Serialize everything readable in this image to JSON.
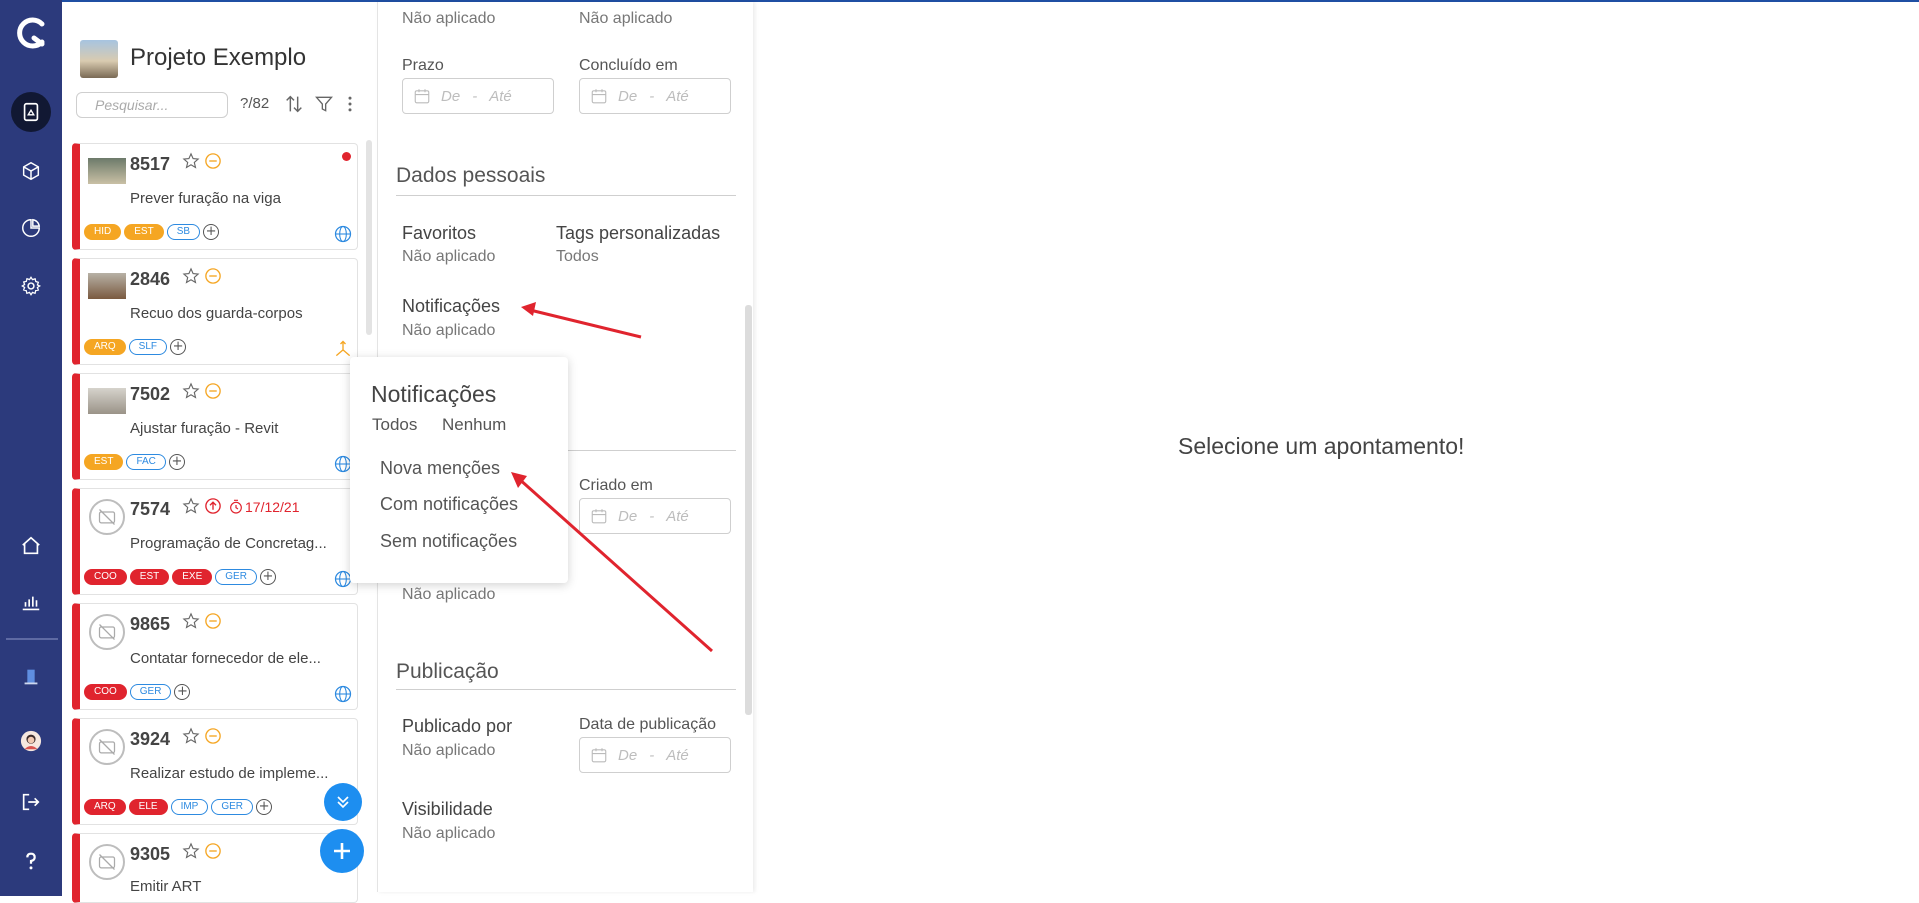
{
  "project": {
    "title": "Projeto Exemplo"
  },
  "search": {
    "placeholder": "Pesquisar..."
  },
  "list": {
    "count": "?/82"
  },
  "cards": [
    {
      "num": "8517",
      "desc": "Prever furação na viga",
      "tags": [
        "HID",
        "EST",
        "SB"
      ]
    },
    {
      "num": "2846",
      "desc": "Recuo dos guarda-corpos",
      "tags": [
        "ARQ",
        "SLF"
      ]
    },
    {
      "num": "7502",
      "desc": "Ajustar furação - Revit",
      "tags": [
        "EST",
        "FAC"
      ]
    },
    {
      "num": "7574",
      "desc": "Programação de Concretag...",
      "date": "17/12/21",
      "tags": [
        "COO",
        "EST",
        "EXE",
        "GER"
      ]
    },
    {
      "num": "9865",
      "desc": "Contatar fornecedor de ele...",
      "tags": [
        "COO",
        "GER"
      ]
    },
    {
      "num": "3924",
      "desc": "Realizar estudo de impleme...",
      "tags": [
        "ARQ",
        "ELE",
        "IMP",
        "GER"
      ]
    },
    {
      "num": "9305",
      "desc": "Emitir ART",
      "tags": []
    }
  ],
  "filters": {
    "top_value_1": "Não aplicado",
    "top_value_2": "Não aplicado",
    "prazo_label": "Prazo",
    "concluido_label": "Concluído em",
    "date_from": "De",
    "date_sep": "-",
    "date_to": "Até",
    "dados_pessoais": "Dados pessoais",
    "favoritos_label": "Favoritos",
    "favoritos_value": "Não aplicado",
    "tags_label": "Tags personalizadas",
    "tags_value": "Todos",
    "notificacoes_label": "Notificações",
    "notificacoes_value": "Não aplicado",
    "criado_label": "Criado em",
    "hidden_value": "Não aplicado",
    "publicacao": "Publicação",
    "publicado_label": "Publicado por",
    "publicado_value": "Não aplicado",
    "data_pub_label": "Data de publicação",
    "visibilidade_label": "Visibilidade",
    "visibilidade_value": "Não aplicado"
  },
  "popup": {
    "title": "Notificações",
    "all": "Todos",
    "none": "Nenhum",
    "options": [
      "Nova menções",
      "Com notificações",
      "Sem notificações"
    ]
  },
  "main": {
    "empty_message": "Selecione um apontamento!"
  },
  "colors": {
    "rail": "#2c3a7c",
    "accent": "#1d8ef0",
    "alert": "#e0242e",
    "warning": "#f5a623"
  }
}
